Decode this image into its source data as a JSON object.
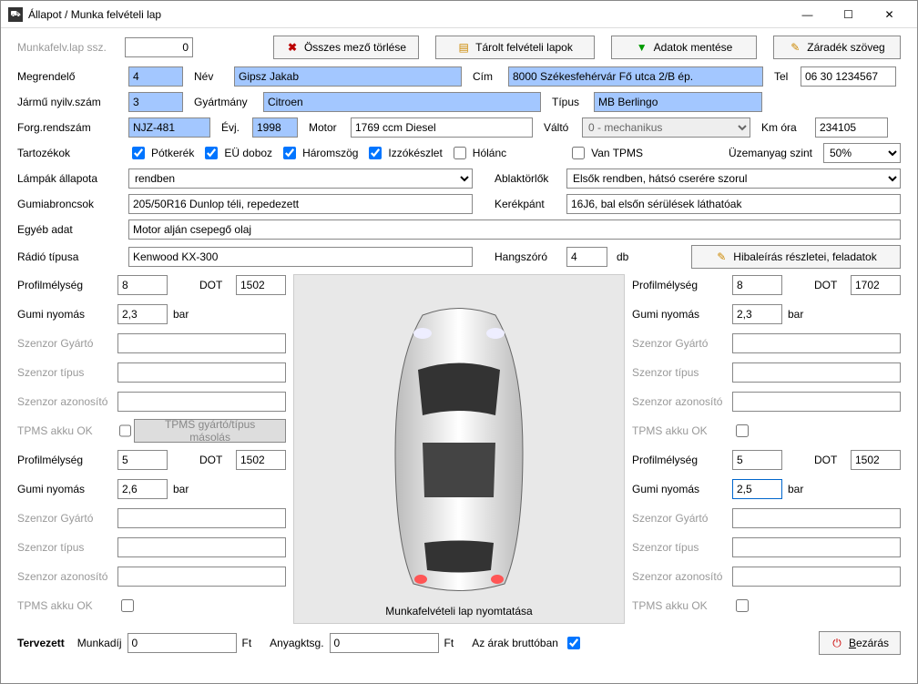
{
  "title": "Állapot / Munka felvételi lap",
  "toolbar": {
    "clear": "Összes mező törlése",
    "stored": "Tárolt felvételi lapok",
    "save": "Adatok mentése",
    "endorse": "Záradék szöveg"
  },
  "fields": {
    "worksheet_no_lbl": "Munkafelv.lap ssz.",
    "worksheet_no": "0",
    "customer_lbl": "Megrendelő",
    "customer": "4",
    "name_lbl": "Név",
    "name": "Gipsz Jakab",
    "addr_lbl": "Cím",
    "addr": "8000 Székesfehérvár Fő utca 2/B ép.",
    "tel_lbl": "Tel",
    "tel": "06 30 1234567",
    "reg_lbl": "Jármű nyilv.szám",
    "reg": "3",
    "make_lbl": "Gyártmány",
    "make": "Citroen",
    "type_lbl": "Típus",
    "type": "MB Berlingo",
    "plate_lbl": "Forg.rendszám",
    "plate": "NJZ-481",
    "year_lbl": "Évj.",
    "year": "1998",
    "engine_lbl": "Motor",
    "engine": "1769 ccm Diesel",
    "gearbox_lbl": "Váltó",
    "gearbox": "0 - mechanikus",
    "km_lbl": "Km óra",
    "km": "234105",
    "acc_lbl": "Tartozékok",
    "acc_spare": "Pótkerék",
    "acc_firstaid": "EÜ doboz",
    "acc_triangle": "Háromszög",
    "acc_bulbs": "Izzókészlet",
    "acc_chain": "Hólánc",
    "has_tpms": "Van TPMS",
    "fuel_lbl": "Üzemanyag szint",
    "fuel": "50%",
    "lights_lbl": "Lámpák állapota",
    "lights": "rendben",
    "wipers_lbl": "Ablaktörlők",
    "wipers": "Elsők rendben, hátsó cserére szorul",
    "tires_lbl": "Gumiabroncsok",
    "tires": "205/50R16 Dunlop téli, repedezett",
    "rims_lbl": "Kerékpánt",
    "rims": "16J6, bal elsőn sérülések láthatóak",
    "other_lbl": "Egyéb adat",
    "other": "Motor alján csepegő olaj",
    "radio_lbl": "Rádió típusa",
    "radio": "Kenwood KX-300",
    "speaker_lbl": "Hangszóró",
    "speaker": "4",
    "speaker_unit": "db",
    "fault_btn": "Hibaleírás részletei, feladatok"
  },
  "wheel_labels": {
    "profile": "Profilmélység",
    "dot": "DOT",
    "pressure": "Gumi nyomás",
    "bar": "bar",
    "sensor_make": "Szenzor Gyártó",
    "sensor_type": "Szenzor típus",
    "sensor_id": "Szenzor azonosító",
    "tpms_batt": "TPMS akku OK",
    "copy_btn": "TPMS gyártó/típus másolás"
  },
  "wheels": {
    "fl": {
      "profile": "8",
      "dot": "1502",
      "pressure": "2,3"
    },
    "fr": {
      "profile": "8",
      "dot": "1702",
      "pressure": "2,3"
    },
    "rl": {
      "profile": "5",
      "dot": "1502",
      "pressure": "2,6"
    },
    "rr": {
      "profile": "5",
      "dot": "1502",
      "pressure": "2,5"
    }
  },
  "mid": {
    "print": "Munkafelvételi lap nyomtatása"
  },
  "bottom": {
    "planned": "Tervezett",
    "labor": "Munkadíj",
    "labor_val": "0",
    "ft": "Ft",
    "material": "Anyagktsg.",
    "material_val": "0",
    "gross": "Az árak bruttóban",
    "close": "Bezárás"
  }
}
